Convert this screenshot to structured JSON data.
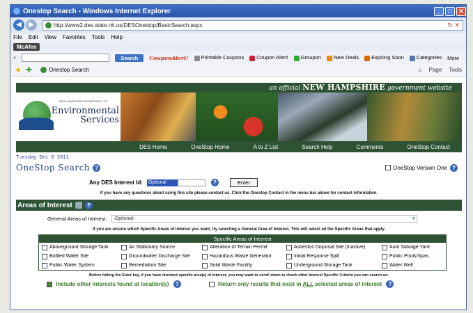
{
  "window": {
    "title": "Onestop Search - Windows Internet Explorer"
  },
  "address": {
    "url": "http://www2.des.state.nh.us/DESOnestop/BasicSearch.aspx"
  },
  "menu": [
    "File",
    "Edit",
    "View",
    "Favorites",
    "Tools",
    "Help"
  ],
  "toolbar": {
    "mcafee": "McAfee",
    "search_button": "Search",
    "coupon_alert": "CouponAlert!",
    "items": [
      "Printable Coupons",
      "Coupon Alert!",
      "Groupon",
      "New Deals",
      "Expiring Soon",
      "Categories",
      "More"
    ]
  },
  "favbar": {
    "tab": "Onestop Search",
    "right": [
      "Page",
      "Tools"
    ]
  },
  "site": {
    "nh_banner_prefix": "an official",
    "nh_banner_state": "NEW HAMPSHIRE",
    "nh_banner_suffix": "government website",
    "logo_small": "NEW HAMPSHIRE DEPARTMENT OF",
    "logo_line1": "Environmental",
    "logo_line2": "Services",
    "nav": [
      "DES Home",
      "OneStop Home",
      "A to Z List",
      "Search Help",
      "Comments",
      "OneStop Contact"
    ]
  },
  "page": {
    "date": "Tuesday Dec 6 2011",
    "title": "OneStop   Search",
    "version_one": "OneStop Version One",
    "interest_id_label": "Any DES Interest Id:",
    "interest_select": "Optional",
    "enter_button": "Enter",
    "help_text": "If you have any questions about using this site please contact us. Click the Onestop Contact in the menu bar above for contact information.",
    "areas_title": "Areas of Interest",
    "general_label": "General Areas of Interest:",
    "general_select": "-Optional-",
    "unsure_text": "If you are unsure which Specific Areas of Interest you want, try selecting a General Area of Interest. This will select all the Specific Areas that apply.",
    "specific_header": "Specific Areas of Interest",
    "specific_rows": [
      [
        "Aboveground Storage Tank",
        "Air Stationary Source",
        "Alteration of Terrain Permit",
        "Asbestos Disposal Site (Inactive)",
        "Auto Salvage Yard"
      ],
      [
        "Bottled Water Site",
        "Groundwater Discharge Site",
        "Hazardous Waste Generator",
        "Initial Response Spill",
        "Public Pools/Spas"
      ],
      [
        "Public Water System",
        "Remediation Site",
        "Solid Waste Facility",
        "Underground Storage Tank",
        "Water Well"
      ]
    ],
    "enter_note": "Before hitting the Enter key, if you have checked specific area(s) of interest, you may want to scroll down to check other Interest Specific Criteria you can search on.",
    "include_other": "Include other interests found at location(s)",
    "return_only_prefix": "Return only results that exist in",
    "return_only_all": "ALL",
    "return_only_suffix": "selected areas of interest"
  }
}
